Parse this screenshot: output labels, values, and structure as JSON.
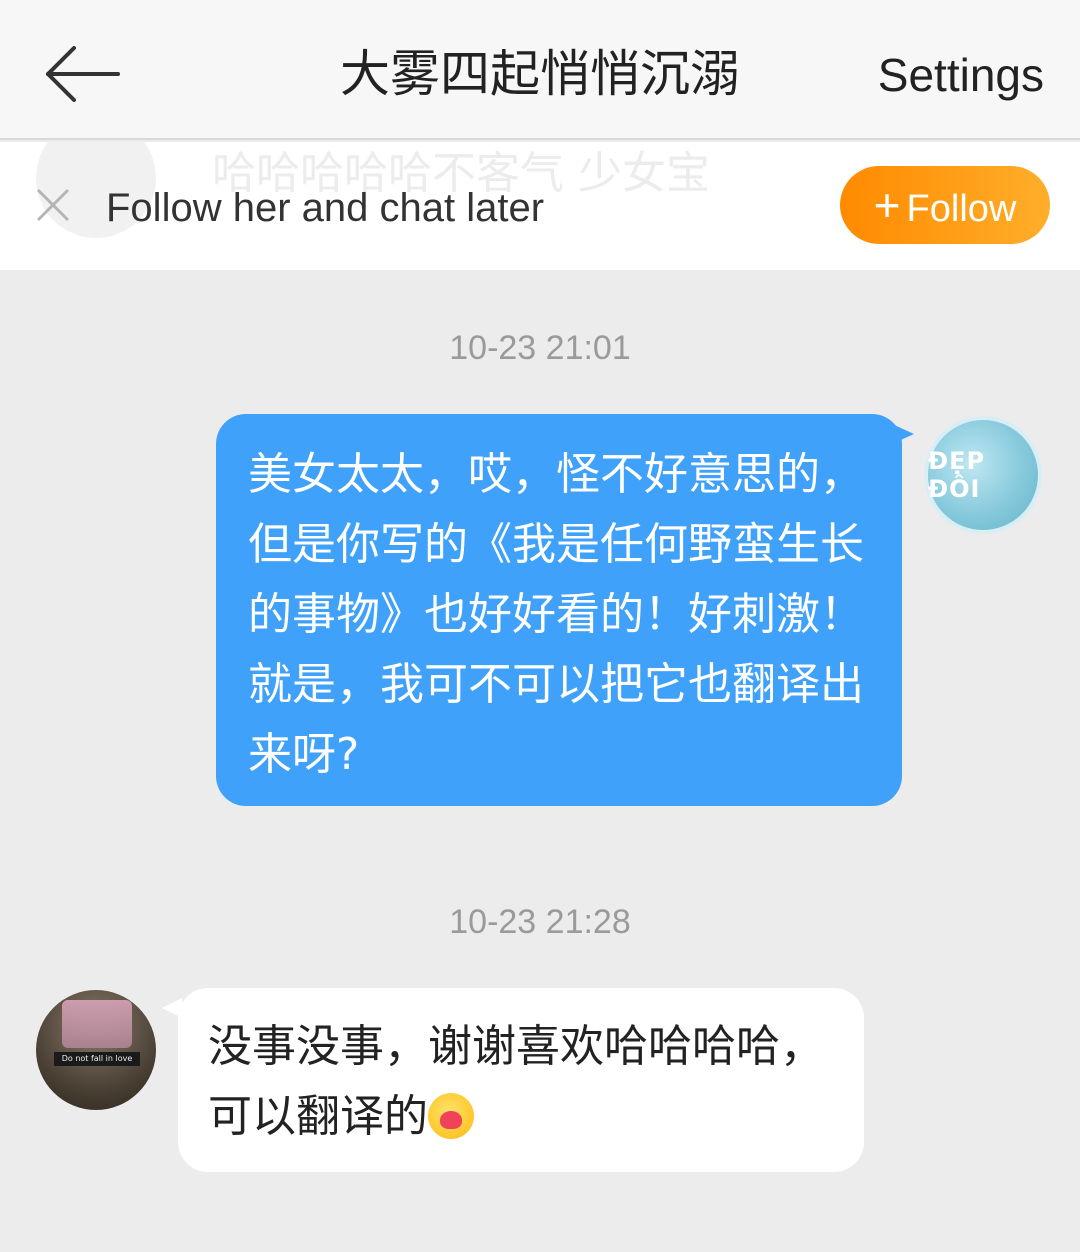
{
  "header": {
    "title": "大雾四起悄悄沉溺",
    "settings_label": "Settings"
  },
  "follow_banner": {
    "ghost_text": "哈哈哈哈哈不客气 少女宝",
    "hint": "Follow her and chat later",
    "follow_button": "Follow"
  },
  "messages": [
    {
      "timestamp": "10-23 21:01",
      "direction": "out",
      "avatar_text": "ĐẸP ĐÔI",
      "text": "美女太太，哎，怪不好意思的，但是你写的《我是任何野蛮生长的事物》也好好看的！好刺激！就是，我可不可以把它也翻译出来呀?"
    },
    {
      "timestamp": "10-23 21:28",
      "direction": "in",
      "avatar_sticker": "Do not fall in love",
      "text": "没事没事，谢谢喜欢哈哈哈哈，可以翻译的"
    }
  ],
  "colors": {
    "accent_orange": "#ff8a00",
    "bubble_blue": "#3fa1f9",
    "background": "#ececec"
  }
}
